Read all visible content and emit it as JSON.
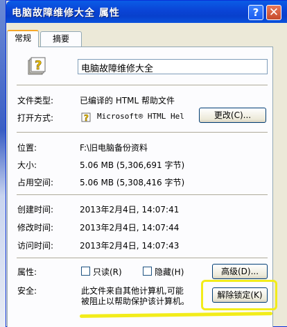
{
  "window": {
    "title": "电脑故障维修大全 属性",
    "help_glyph": "?",
    "close_glyph": "✕"
  },
  "tabs": [
    {
      "label": "常规",
      "active": true
    },
    {
      "label": "摘要",
      "active": false
    }
  ],
  "general": {
    "file_name": "电脑故障维修大全",
    "file_type_label": "文件类型:",
    "file_type_value": "已编译的 HTML 帮助文件",
    "opens_with_label": "打开方式:",
    "opens_with_value": "Microsoft® HTML Hel",
    "change_button": "更改(C)...",
    "location_label": "位置:",
    "location_value": "F:\\旧电脑备份资料",
    "size_label": "大小:",
    "size_value": "5.06 MB (5,306,691 字节)",
    "size_on_disk_label": "占用空间:",
    "size_on_disk_value": "5.06 MB (5,308,416 字节)",
    "created_label": "创建时间:",
    "created_value": "2013年2月4日, 14:07:41",
    "modified_label": "修改时间:",
    "modified_value": "2013年2月4日, 14:07:44",
    "accessed_label": "访问时间:",
    "accessed_value": "2013年2月4日, 14:07:43",
    "attributes_label": "属性:",
    "readonly_label": "只读(R)",
    "readonly_checked": false,
    "hidden_label": "隐藏(H)",
    "hidden_checked": false,
    "advanced_button": "高级(D)...",
    "security_label": "安全:",
    "security_text_line1": "此文件来自其他计算机,可能",
    "security_text_line2": "被阻止以帮助保护该计算机。",
    "unblock_button": "解除锁定(K)"
  },
  "colors": {
    "titlebar": "#0a44d6",
    "highlight": "#f2ec1a",
    "dialog_bg": "#ece9d8"
  },
  "icons": {
    "file_icon": "help-file-icon",
    "opens_with_icon": "html-help-icon"
  }
}
